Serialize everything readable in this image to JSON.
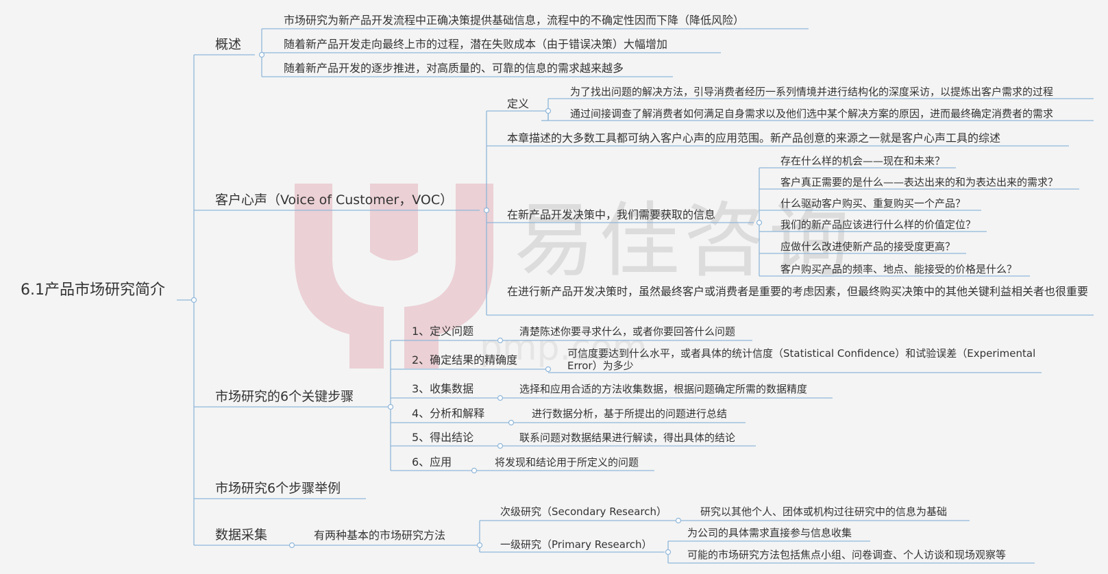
{
  "watermark": {
    "text": "易佳咨询",
    "url": "pmp.com",
    "logo": "yijia-logo-icon",
    "color": "#e9c9cf"
  },
  "colors": {
    "connector": "#8eb6d9",
    "background": "#f4f4f4",
    "text": "#333333"
  },
  "root": {
    "label": "6.1产品市场研究简介"
  },
  "overview": {
    "label": "概述",
    "items": [
      "市场研究为新产品开发流程中正确决策提供基础信息，流程中的不确定性因而下降（降低风险）",
      "随着新产品开发走向最终上市的过程，潜在失败成本（由于错误决策）大幅增加",
      "随着新产品开发的逐步推进，对高质量的、可靠的信息的需求越来越多"
    ]
  },
  "voc": {
    "label": "客户心声（Voice of Customer，VOC）",
    "definition": {
      "label": "定义",
      "items": [
        "为了找出问题的解决方法，引导消费者经历一系列情境并进行结构化的深度采访，以提炼出客户需求的过程",
        "通过间接调查了解消费者如何满足自身需求以及他们选中某个解决方案的原因，进而最终确定消费者的需求"
      ]
    },
    "tools_note": "本章描述的大多数工具都可纳入客户心声的应用范围。新产品创意的来源之一就是客户心声工具的综述",
    "info": {
      "label": "在新产品开发决策中，我们需要获取的信息",
      "items": [
        "存在什么样的机会——现在和未来？",
        "客户真正需要的是什么——表达出来的和为表达出来的需求？",
        "什么驱动客户购买、重复购买一个产品？",
        "我们的新产品应该进行什么样的价值定位？",
        "应做什么改进使新产品的接受度更高？",
        "客户购买产品的频率、地点、能接受的价格是什么？"
      ]
    },
    "stakeholders": "在进行新产品开发决策时，虽然最终客户或消费者是重要的考虑因素，但最终购买决策中的其他关键利益相关者也很重要"
  },
  "steps": {
    "label": "市场研究的6个关键步骤",
    "items": [
      {
        "label": "1、定义问题",
        "desc": "清楚陈述你要寻求什么，或者你要回答什么问题"
      },
      {
        "label": "2、确定结果的精确度",
        "desc": "可信度要达到什么水平，或者具体的统计信度（Statistical Confidence）和试验误差（Experimental Error）为多少"
      },
      {
        "label": "3、收集数据",
        "desc": "选择和应用合适的方法收集数据，根据问题确定所需的数据精度"
      },
      {
        "label": "4、分析和解释",
        "desc": "进行数据分析，基于所提出的问题进行总结"
      },
      {
        "label": "5、得出结论",
        "desc": "联系问题对数据结果进行解读，得出具体的结论"
      },
      {
        "label": "6、应用",
        "desc": "将发现和结论用于所定义的问题"
      }
    ]
  },
  "example": {
    "label": "市场研究6个步骤举例"
  },
  "data_collection": {
    "label": "数据采集",
    "methods_label": "有两种基本的市场研究方法",
    "secondary": {
      "label": "次级研究（Secondary Research）",
      "desc": "研究以其他个人、团体或机构过往研究中的信息为基础"
    },
    "primary": {
      "label": "一级研究（Primary Research）",
      "items": [
        "为公司的具体需求直接参与信息收集",
        "可能的市场研究方法包括焦点小组、问卷调查、个人访谈和现场观察等"
      ]
    }
  }
}
